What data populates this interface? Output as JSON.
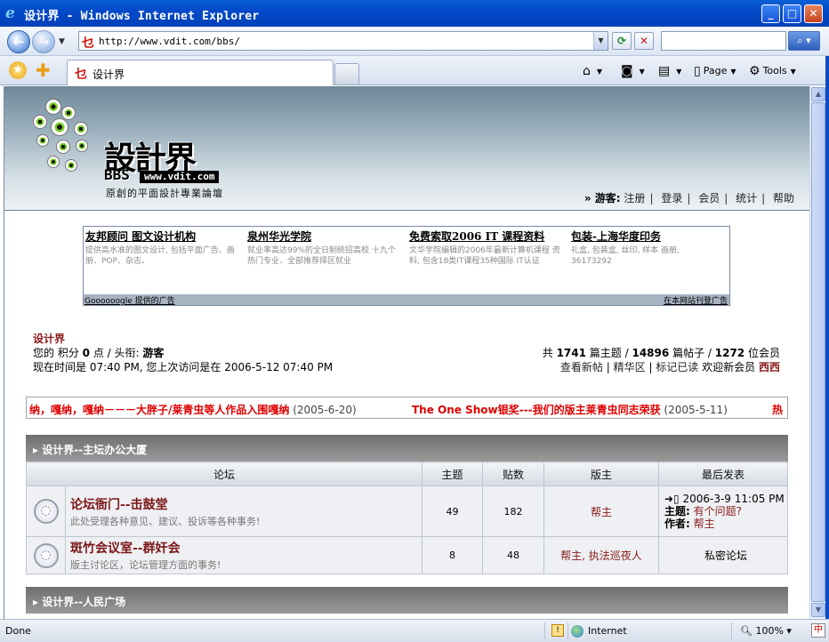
{
  "window": {
    "title": "设计界 - Windows Internet Explorer",
    "minimize": "_",
    "maximize": "□",
    "close": "✕"
  },
  "address_bar": {
    "url": "http://www.vdit.com/bbs/",
    "search_placeholder": ""
  },
  "toolbar": {
    "tab_title": "设计界",
    "page_label": "Page",
    "tools_label": "Tools"
  },
  "header": {
    "logo_text": "設計界",
    "logo_bbs": "BBS",
    "logo_url": "www.vdit.com",
    "tagline": "原創的平面設計專業論壇",
    "guest_label": "» 游客:",
    "nav": [
      "注册",
      "登录",
      "会员",
      "统计",
      "帮助"
    ]
  },
  "ads": {
    "items": [
      {
        "title": "友邦顾问 图文设计机构",
        "desc": "提供高水准的图文设计, 包括平面广告、画册、POP、杂志、"
      },
      {
        "title": "泉州华光学院",
        "desc": "就业率高达99%的全日制统招高校 十九个热门专业、全部推荐择区就业"
      },
      {
        "title": "免费索取2006 IT 课程资料",
        "desc": "文华学院编辑的2006年最新计算机课程 资料, 包含18类IT课程35种国际 IT认证"
      },
      {
        "title": "包装-上海华度印务",
        "desc": "礼盒, 包装盒, 丝印, 样本 画册, 36173292"
      }
    ],
    "footer_left": "Goooooogle 提供的广告",
    "footer_right": "在本网站刊登广告"
  },
  "user_info": {
    "site_name": "设计界",
    "line1_prefix": "您的 积分",
    "points": "0",
    "line1_mid": "点 / 头衔:",
    "title": "游客",
    "line2": "现在时间是 07:40 PM, 您上次访问是在 2006-5-12 07:40 PM"
  },
  "stats": {
    "prefix": "共",
    "topics": "1741",
    "topics_label": "篇主题 /",
    "posts": "14896",
    "posts_label": "篇帖子 /",
    "members": "1272",
    "members_label": "位会员",
    "links": [
      "查看新帖",
      "精华区",
      "标记已读"
    ],
    "welcome": "欢迎新会员",
    "new_member": "西西"
  },
  "marquee": [
    {
      "text": "纳，嘎纳，嘎纳－－－大胖子/莱青虫等人作品入围嘎纳",
      "date": "(2005-6-20)"
    },
    {
      "text": "The One Show银奖---我们的版主莱青虫同志荣获",
      "date": "(2005-5-11)"
    },
    {
      "text": "热",
      "date": ""
    }
  ],
  "categories": [
    {
      "name": "设计界--主坛办公大厦"
    },
    {
      "name": "设计界--人民广场"
    }
  ],
  "table": {
    "headers": [
      "论坛",
      "主题",
      "贴数",
      "版主",
      "最后发表"
    ],
    "rows": [
      {
        "name": "论坛衙门--击鼓堂",
        "desc": "此处受理各种意见、建议、投诉等各种事务!",
        "topics": "49",
        "posts": "182",
        "moderator": "帮主",
        "last_time": "2006-3-9 11:05 PM",
        "last_subject_label": "主题:",
        "last_subject": "有个问题?",
        "last_author_label": "作者:",
        "last_author": "帮主"
      },
      {
        "name": "斑竹会议室--群奸会",
        "desc": "版主讨论区，论坛管理方面的事务!",
        "topics": "8",
        "posts": "48",
        "moderator": "帮主, 执法巡夜人",
        "last_private": "私密论坛"
      }
    ]
  },
  "status_bar": {
    "status": "Done",
    "zone": "Internet",
    "zoom": "100%"
  },
  "colors": {
    "title_bar": "#0349c9",
    "forum_title": "#7a1616",
    "marquee_highlight": "#dd0000",
    "category_bar": "#7f7f7f"
  }
}
